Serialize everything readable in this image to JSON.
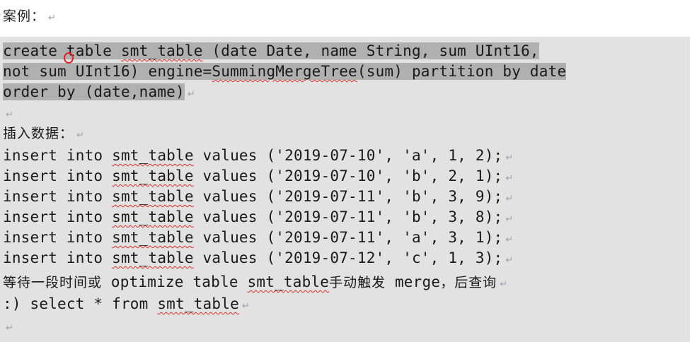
{
  "heading": "案例：",
  "para_mark": "↵",
  "create_stmt": {
    "line1": {
      "pre": "create table ",
      "tbl": "smt_table",
      "post": " (date Date, name String, sum UInt16,"
    },
    "line2": {
      "pre": "not sum UInt16) engine=",
      "engine": "SummingMergeTree",
      "post": "(sum) partition by date"
    },
    "line3": "order by (date,name)"
  },
  "insert_label": "插入数据：",
  "inserts": [
    {
      "kw": "insert into ",
      "tbl": "smt_table",
      "vals": " values ('2019-07-10', 'a', 1, 2);"
    },
    {
      "kw": "insert into ",
      "tbl": "smt_table",
      "vals": " values ('2019-07-10', 'b', 2, 1);"
    },
    {
      "kw": "insert into ",
      "tbl": "smt_table",
      "vals": " values ('2019-07-11', 'b', 3, 9);"
    },
    {
      "kw": "insert into ",
      "tbl": "smt_table",
      "vals": " values ('2019-07-11', 'b', 3, 8);"
    },
    {
      "kw": "insert into ",
      "tbl": "smt_table",
      "vals": " values ('2019-07-11', 'a', 3, 1);"
    },
    {
      "kw": "insert into ",
      "tbl": "smt_table",
      "vals": " values ('2019-07-12', 'c', 1, 3);"
    }
  ],
  "wait_line": {
    "pre": "等待一段时间或",
    "mid": " optimize table ",
    "tbl": "smt_table",
    "post": "手动触发",
    "merge": " merge",
    "tail": "，后查询"
  },
  "select_line": {
    "pre": ":) select * from ",
    "tbl": "smt_table"
  }
}
